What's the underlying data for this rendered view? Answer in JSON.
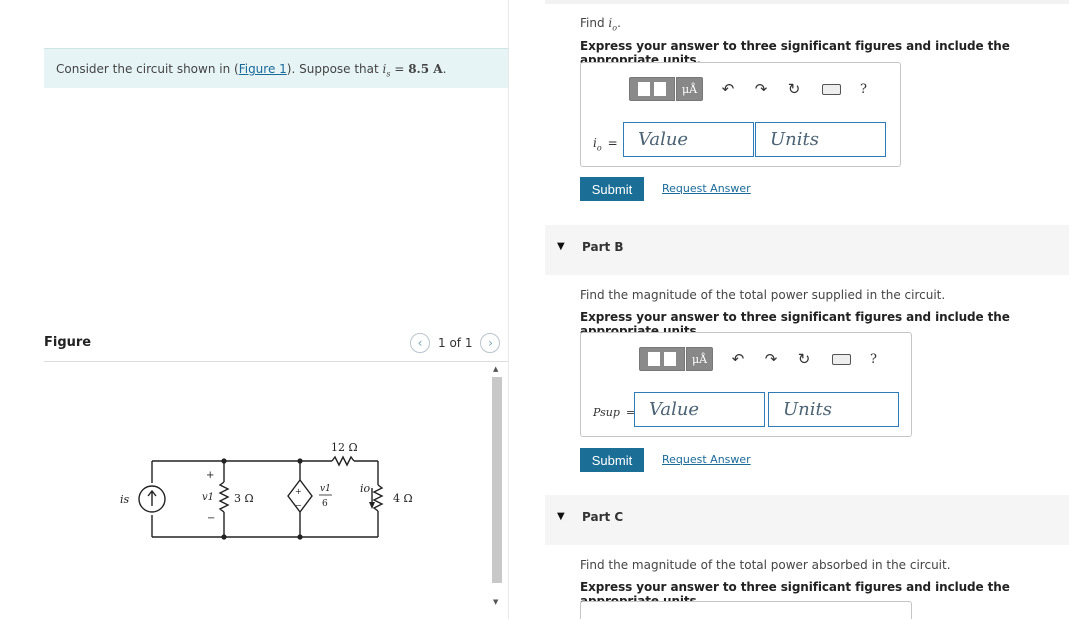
{
  "problem": {
    "prefix": "Consider the circuit shown in (",
    "figure_link": "Figure 1",
    "suffix": "). Suppose that ",
    "var": "is",
    "eq": " = ",
    "value": "8.5 A",
    "end": "."
  },
  "figure": {
    "title": "Figure",
    "pager": "1 of 1",
    "circuit_labels": {
      "is": "is",
      "v1": "v1",
      "r1": "3 Ω",
      "r2": "12 Ω",
      "r3": "4 Ω",
      "dep_num": "v1",
      "dep_den": "6",
      "io": "io",
      "plus": "+",
      "minus": "−"
    }
  },
  "part_a": {
    "find_prefix": "Find ",
    "find_var": "io",
    "find_suffix": ".",
    "instruction": "Express your answer to three significant figures and include the appropriate units.",
    "var_label": "io",
    "eq": "=",
    "value_placeholder": "Value",
    "units_placeholder": "Units",
    "submit": "Submit",
    "request": "Request Answer"
  },
  "part_b": {
    "label": "Part B",
    "question": "Find the magnitude of the total power supplied in the circuit.",
    "instruction": "Express your answer to three significant figures and include the appropriate units.",
    "var_label": "Psup",
    "eq": "=",
    "value_placeholder": "Value",
    "units_placeholder": "Units",
    "submit": "Submit",
    "request": "Request Answer"
  },
  "part_c": {
    "label": "Part C",
    "question": "Find the magnitude of the total power absorbed in the circuit.",
    "instruction": "Express your answer to three significant figures and include the appropriate units."
  },
  "toolbar": {
    "units_glyph": "μÅ",
    "undo_icon": "↶",
    "redo_icon": "↷",
    "reset_icon": "↻",
    "help": "?"
  },
  "colors": {
    "accent": "#1b6f96",
    "problem_bg": "#e6f4f6",
    "input_border": "#2e7bb8"
  }
}
